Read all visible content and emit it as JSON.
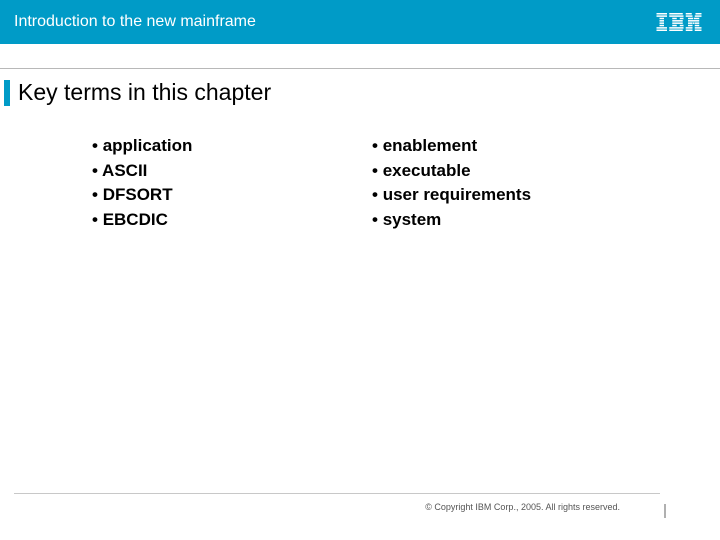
{
  "header": {
    "title": "Introduction to the new mainframe",
    "logo_name": "ibm-logo"
  },
  "chapter_title": "Key terms in this chapter",
  "terms": {
    "left": [
      "application",
      "ASCII",
      "DFSORT",
      "EBCDIC"
    ],
    "right": [
      "enablement",
      "executable",
      "user requirements",
      "system"
    ]
  },
  "footer": {
    "copyright": "© Copyright IBM Corp., 2005. All rights reserved."
  }
}
